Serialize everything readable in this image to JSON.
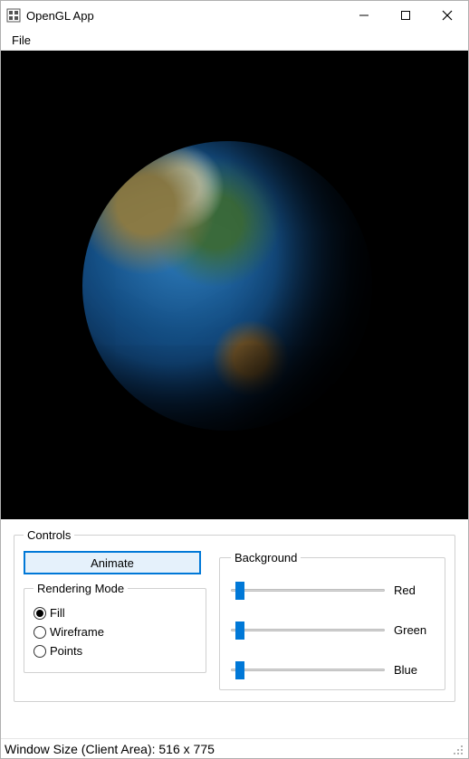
{
  "window": {
    "title": "OpenGL App"
  },
  "menubar": {
    "file": "File"
  },
  "controls": {
    "group_label": "Controls",
    "animate_label": "Animate",
    "rendering_mode": {
      "legend": "Rendering Mode",
      "options": {
        "fill": "Fill",
        "wireframe": "Wireframe",
        "points": "Points"
      },
      "selected": "fill"
    },
    "background": {
      "legend": "Background",
      "sliders": {
        "red": {
          "label": "Red",
          "value": 0.03
        },
        "green": {
          "label": "Green",
          "value": 0.03
        },
        "blue": {
          "label": "Blue",
          "value": 0.03
        }
      }
    }
  },
  "statusbar": {
    "text": "Window Size (Client Area): 516 x 775"
  },
  "colors": {
    "accent": "#0078d7",
    "viewport_bg": "#000000"
  }
}
